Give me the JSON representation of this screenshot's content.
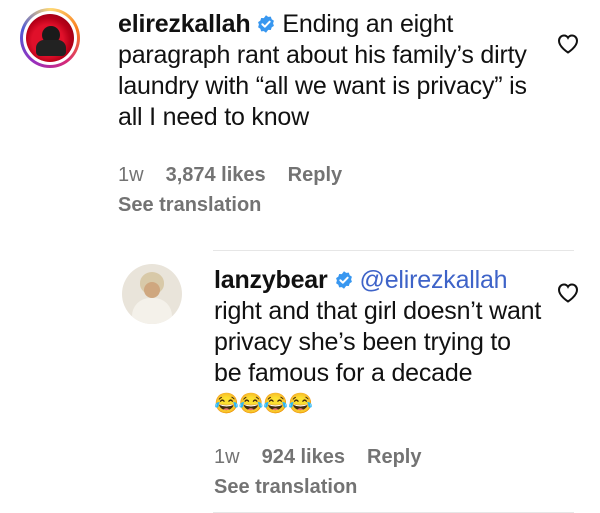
{
  "comments": [
    {
      "username": "elirezkallah",
      "verified": true,
      "text": "Ending an eight paragraph rant about his family’s dirty laundry with “all we want is privacy” is all I need to know",
      "time": "1w",
      "likes": "3,874 likes",
      "reply_label": "Reply",
      "see_translation": "See translation"
    }
  ],
  "replies": [
    {
      "username": "lanzybear",
      "verified": true,
      "mention": "@elirezkallah",
      "text": "right and that girl doesn’t want privacy she’s been trying to be famous for a decade",
      "emojis": "😂😂😂😂",
      "time": "1w",
      "likes": "924 likes",
      "reply_label": "Reply",
      "see_translation": "See translation"
    }
  ],
  "icons": {
    "like": "heart-outline-icon",
    "verified": "verified-badge-icon"
  },
  "colors": {
    "verified": "#3897f0",
    "mention": "#3e63c8",
    "meta": "#737373"
  }
}
